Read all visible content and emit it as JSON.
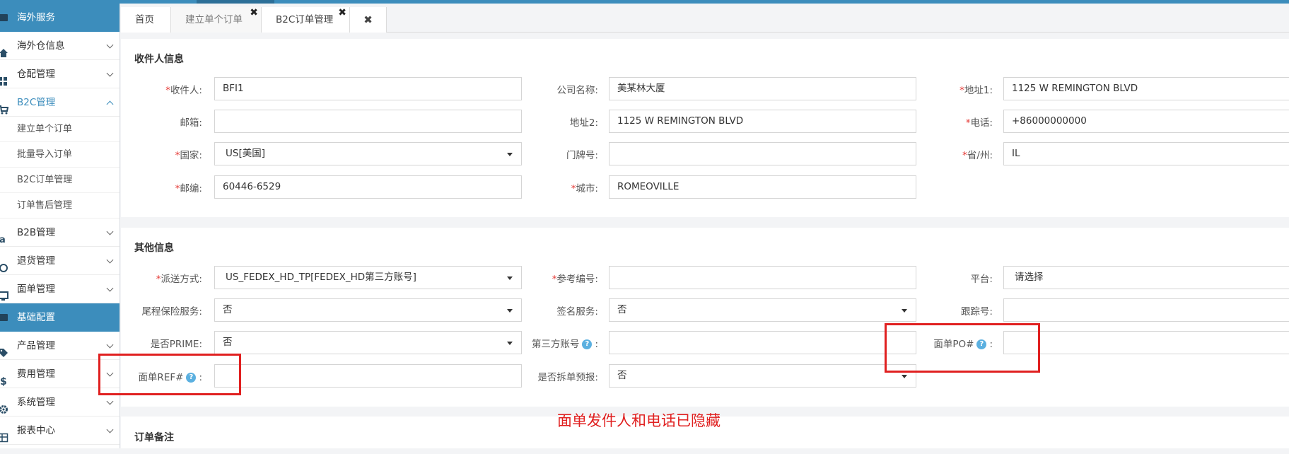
{
  "sidebar": {
    "items": [
      {
        "label": "海外服务",
        "type": "section"
      },
      {
        "label": "海外仓信息"
      },
      {
        "label": "仓配管理"
      },
      {
        "label": "B2C管理",
        "active": true
      },
      {
        "label": "建立单个订单",
        "sub": true
      },
      {
        "label": "批量导入订单",
        "sub": true
      },
      {
        "label": "B2C订单管理",
        "sub": true
      },
      {
        "label": "订单售后管理",
        "sub": true
      },
      {
        "label": "B2B管理"
      },
      {
        "label": "退货管理"
      },
      {
        "label": "面单管理"
      },
      {
        "label": "基础配置",
        "type": "section"
      },
      {
        "label": "产品管理"
      },
      {
        "label": "费用管理"
      },
      {
        "label": "系统管理"
      },
      {
        "label": "报表中心"
      }
    ]
  },
  "tabs": [
    "首页",
    "建立单个订单",
    "B2C订单管理"
  ],
  "tab_close_glyph": "✖",
  "sections": {
    "recipient_title": "收件人信息",
    "other_title": "其他信息",
    "remark_title": "订单备注"
  },
  "recipient": {
    "name_label": "收件人:",
    "name": "BFI1",
    "company_label": "公司名称:",
    "company": "美某林大厦",
    "addr1_label": "地址1:",
    "addr1": "1125 W REMINGTON BLVD",
    "email_label": "邮箱:",
    "email": "",
    "addr2_label": "地址2:",
    "addr2": "1125 W REMINGTON BLVD",
    "phone_label": "电话:",
    "phone": "+86000000000",
    "country_label": "国家:",
    "country": "US[美国]",
    "house_label": "门牌号:",
    "house": "",
    "state_label": "省/州:",
    "state": "IL",
    "zip_label": "邮编:",
    "zip": "60446-6529",
    "city_label": "城市:",
    "city": "ROMEOVILLE"
  },
  "other": {
    "ship_label": "派送方式:",
    "ship": "US_FEDEX_HD_TP[FEDEX_HD第三方账号]",
    "ref_label": "参考编号:",
    "ref": "",
    "platform_label": "平台:",
    "platform": "请选择",
    "insurance_label": "尾程保险服务:",
    "insurance": "否",
    "sign_label": "签名服务:",
    "sign": "否",
    "tracking_label": "跟踪号:",
    "tracking": "",
    "prime_label": "是否PRIME:",
    "prime": "否",
    "third_label": "第三方账号",
    "third": "",
    "po_label": "面单PO#",
    "po": "",
    "refno_label": "面单REF#",
    "refno": "",
    "split_label": "是否拆单预报:",
    "split": "否"
  },
  "help_glyph": "?",
  "colon": ":",
  "annotation": "面单发件人和电话已隐藏"
}
